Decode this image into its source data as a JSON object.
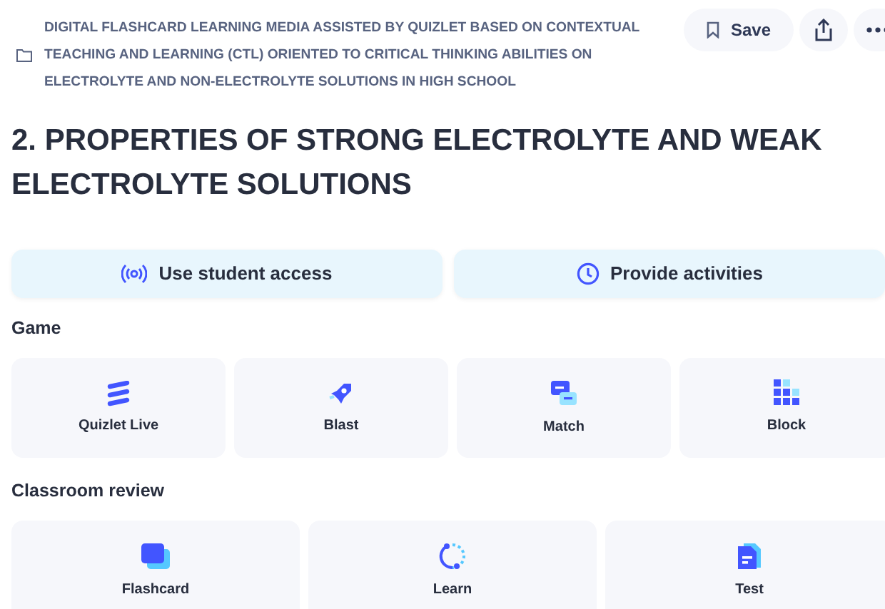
{
  "header": {
    "folder_title": "DIGITAL FLASHCARD LEARNING MEDIA ASSISTED BY QUIZLET BASED ON CONTEXTUAL TEACHING AND LEARNING (CTL) ORIENTED TO CRITICAL THINKING ABILITIES ON ELECTROLYTE AND NON-ELECTROLYTE SOLUTIONS IN HIGH SCHOOL",
    "save_label": "Save"
  },
  "title": "2. PROPERTIES OF STRONG ELECTROLYTE AND WEAK ELECTROLYTE SOLUTIONS",
  "actions": [
    {
      "kind": "broadcast",
      "label": "Use student access"
    },
    {
      "kind": "clock",
      "label": "Provide activities"
    }
  ],
  "sections": [
    {
      "heading": "Game",
      "items": [
        {
          "kind": "live",
          "label": "Quizlet Live"
        },
        {
          "kind": "blast",
          "label": "Blast"
        },
        {
          "kind": "match",
          "label": "Match"
        },
        {
          "kind": "block",
          "label": "Block"
        }
      ]
    },
    {
      "heading": "Classroom review",
      "items": [
        {
          "kind": "flashcard",
          "label": "Flashcard"
        },
        {
          "kind": "learn",
          "label": "Learn"
        },
        {
          "kind": "test",
          "label": "Test"
        }
      ]
    }
  ]
}
